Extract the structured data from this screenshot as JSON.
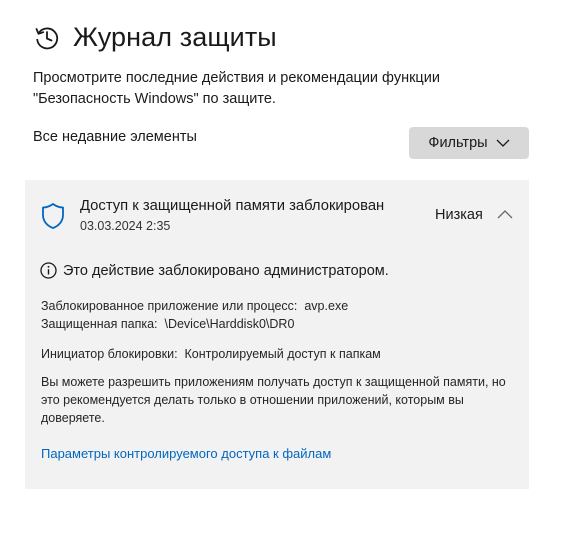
{
  "header": {
    "icon": "history-clock-icon",
    "title": "Журнал защиты"
  },
  "description": "Просмотрите последние действия и рекомендации функции \"Безопасность Windows\" по защите.",
  "section_label": "Все недавние элементы",
  "filters": {
    "label": "Фильтры",
    "icon": "chevron-down-icon"
  },
  "event": {
    "icon": "shield-icon",
    "title": "Доступ к защищенной памяти заблокирован",
    "date": "03.03.2024 2:35",
    "severity": "Низкая",
    "collapse_icon": "chevron-up-icon",
    "admin_notice": "Это действие заблокировано администратором.",
    "blocked_app_label": "Заблокированное приложение или процесс:",
    "blocked_app_value": "avp.exe",
    "protected_folder_label": "Защищенная папка:",
    "protected_folder_value": "\\Device\\Harddisk0\\DR0",
    "initiator_label": "Инициатор блокировки:",
    "initiator_value": "Контролируемый доступ к папкам",
    "explanation": "Вы можете разрешить приложениям получать доступ к защищенной памяти, но это рекомендуется делать только в отношении приложений, которым вы доверяете.",
    "link": "Параметры контролируемого доступа к файлам"
  },
  "colors": {
    "accent": "#0067c0",
    "card_background": "#f2f2f2",
    "button_background": "#d8d8d8"
  }
}
